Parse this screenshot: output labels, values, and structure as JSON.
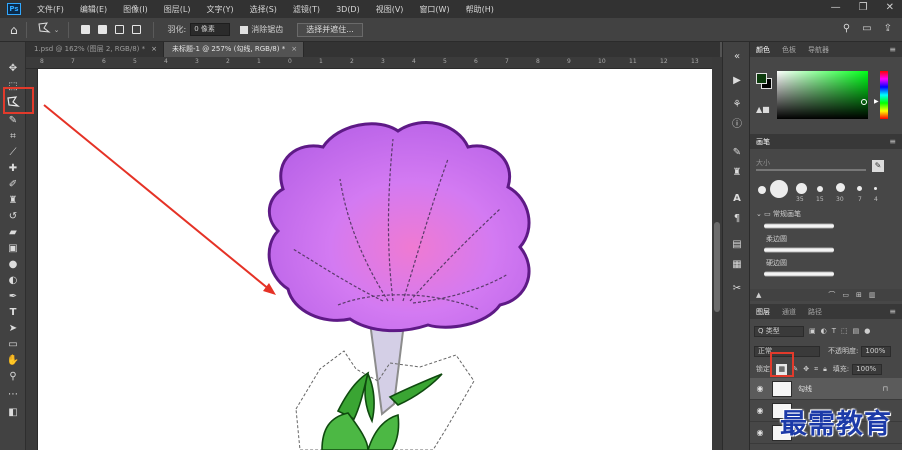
{
  "app": {
    "logo": "Ps",
    "menu": [
      "文件(F)",
      "编辑(E)",
      "图像(I)",
      "图层(L)",
      "文字(Y)",
      "选择(S)",
      "滤镜(T)",
      "3D(D)",
      "视图(V)",
      "窗口(W)",
      "帮助(H)"
    ],
    "window_controls": [
      "—",
      "❐",
      "✕"
    ]
  },
  "options_bar": {
    "feather_label": "羽化:",
    "feather_value": "0 像素",
    "antialias_label": "消除锯齿",
    "select_mask_button": "选择并遮住..."
  },
  "tabs": [
    {
      "label": "1.psd @ 162% (图层 2, RGB/8) *",
      "active": false
    },
    {
      "label": "未标题-1 @ 257% (勾线, RGB/8) *",
      "active": true
    }
  ],
  "ruler": {
    "top_ticks": [
      "8",
      "7",
      "6",
      "5",
      "4",
      "3",
      "2",
      "1",
      "0",
      "1",
      "2",
      "3",
      "4",
      "5",
      "6",
      "7",
      "8",
      "9",
      "10",
      "11",
      "12",
      "13"
    ]
  },
  "color_panel": {
    "tabs": [
      "颜色",
      "色板",
      "导航器"
    ],
    "fg_color": "#0c3b0c",
    "bg_color": "#000000",
    "hue_color": "#00ff19"
  },
  "brush_panel": {
    "tab": "画笔",
    "size_label": "大小",
    "preset_sizes": [
      "35",
      "15",
      "30",
      "7",
      "4"
    ],
    "folder_name": "常规画笔",
    "brushes": [
      "柔边圆",
      "硬边圆"
    ]
  },
  "layers_panel": {
    "tabs": [
      "图层",
      "通道",
      "路径"
    ],
    "filter_kind": "Q 类型",
    "blend_mode": "正常",
    "opacity_label": "不透明度:",
    "opacity_value": "100%",
    "lock_label": "锁定:",
    "fill_label": "填充:",
    "fill_value": "100%",
    "layers": [
      {
        "name": "勾线",
        "active": true,
        "locked": true
      },
      {
        "name": "",
        "active": false,
        "locked": false
      },
      {
        "name": "",
        "active": false,
        "locked": false
      }
    ]
  },
  "watermark": "最需教育",
  "colors": {
    "highlight_red": "#e23a2b",
    "flower_purple": "#c56bf0",
    "outline_purple": "#6b1a9a",
    "stem": "#c9c2dd",
    "leaf_green": "#3aa533",
    "arrow_red": "#e53226"
  }
}
